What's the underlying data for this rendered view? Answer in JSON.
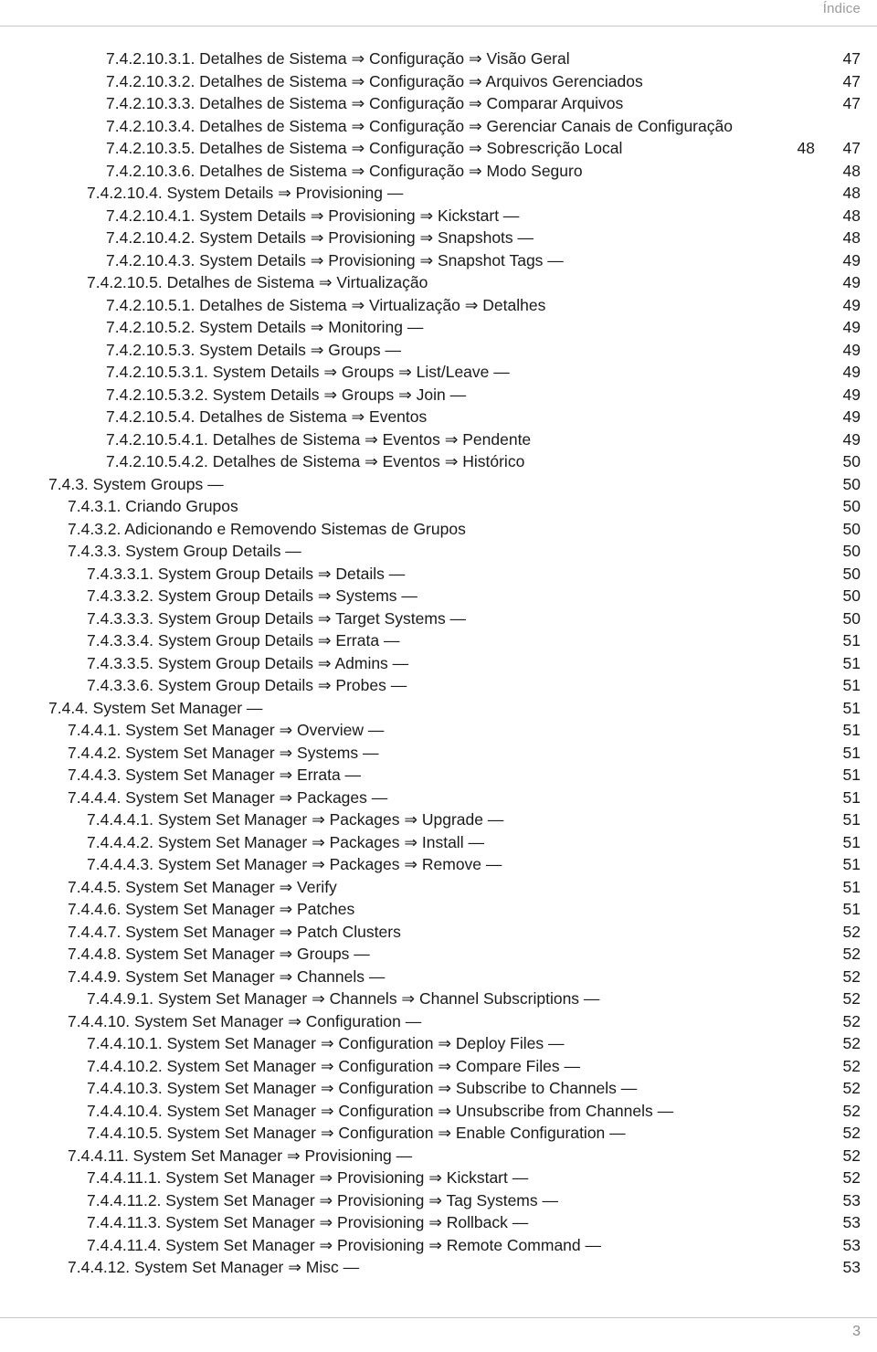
{
  "header": {
    "label": "Índice"
  },
  "footer": {
    "page_number": "3"
  },
  "toc": {
    "entries": [
      {
        "text": "7.4.2.10.3.1. Detalhes de Sistema ⇒ Configuração ⇒ Visão Geral",
        "page": "47",
        "level": 6
      },
      {
        "text": "7.4.2.10.3.2. Detalhes de Sistema ⇒ Configuração ⇒ Arquivos Gerenciados",
        "page": "47",
        "level": 6
      },
      {
        "text": "7.4.2.10.3.3. Detalhes de Sistema ⇒ Configuração ⇒ Comparar Arquivos",
        "page": "47",
        "level": 6
      },
      {
        "text": "7.4.2.10.3.4. Detalhes de Sistema ⇒ Configuração ⇒ Gerenciar Canais de Configuração",
        "page": "",
        "level": 6
      },
      {
        "text": "7.4.2.10.3.5. Detalhes de Sistema ⇒ Configuração ⇒ Sobrescrição Local",
        "page": "47",
        "page_wrapped": "48",
        "level": 6
      },
      {
        "text": "7.4.2.10.3.6. Detalhes de Sistema ⇒ Configuração ⇒ Modo Seguro",
        "page": "48",
        "level": 6
      },
      {
        "text": "7.4.2.10.4. System Details ⇒ Provisioning —",
        "page": "48",
        "level": 5
      },
      {
        "text": "7.4.2.10.4.1. System Details ⇒ Provisioning ⇒ Kickstart —",
        "page": "48",
        "level": 6
      },
      {
        "text": "7.4.2.10.4.2. System Details ⇒ Provisioning ⇒ Snapshots —",
        "page": "48",
        "level": 6
      },
      {
        "text": "7.4.2.10.4.3. System Details ⇒ Provisioning ⇒ Snapshot Tags —",
        "page": "49",
        "level": 6
      },
      {
        "text": "7.4.2.10.5. Detalhes de Sistema ⇒ Virtualização",
        "page": "49",
        "level": 5
      },
      {
        "text": "7.4.2.10.5.1. Detalhes de Sistema ⇒ Virtualização ⇒ Detalhes",
        "page": "49",
        "level": 6
      },
      {
        "text": "7.4.2.10.5.2. System Details ⇒ Monitoring —",
        "page": "49",
        "level": 6
      },
      {
        "text": "7.4.2.10.5.3. System Details ⇒ Groups —",
        "page": "49",
        "level": 6
      },
      {
        "text": "7.4.2.10.5.3.1. System Details ⇒ Groups ⇒ List/Leave —",
        "page": "49",
        "level": 6
      },
      {
        "text": "7.4.2.10.5.3.2. System Details ⇒ Groups ⇒ Join —",
        "page": "49",
        "level": 6
      },
      {
        "text": "7.4.2.10.5.4. Detalhes de Sistema ⇒ Eventos",
        "page": "49",
        "level": 6
      },
      {
        "text": "7.4.2.10.5.4.1. Detalhes de Sistema ⇒ Eventos ⇒ Pendente",
        "page": "49",
        "level": 6
      },
      {
        "text": "7.4.2.10.5.4.2. Detalhes de Sistema ⇒ Eventos ⇒ Histórico",
        "page": "50",
        "level": 6
      },
      {
        "text": "7.4.3. System Groups —",
        "page": "50",
        "level": 3
      },
      {
        "text": "7.4.3.1. Criando Grupos",
        "page": "50",
        "level": 4
      },
      {
        "text": "7.4.3.2. Adicionando e Removendo Sistemas de Grupos",
        "page": "50",
        "level": 4
      },
      {
        "text": "7.4.3.3. System Group Details —",
        "page": "50",
        "level": 4
      },
      {
        "text": "7.4.3.3.1. System Group Details ⇒ Details —",
        "page": "50",
        "level": 5
      },
      {
        "text": "7.4.3.3.2. System Group Details ⇒ Systems —",
        "page": "50",
        "level": 5
      },
      {
        "text": "7.4.3.3.3. System Group Details ⇒ Target Systems —",
        "page": "50",
        "level": 5
      },
      {
        "text": "7.4.3.3.4. System Group Details ⇒ Errata —",
        "page": "51",
        "level": 5
      },
      {
        "text": "7.4.3.3.5. System Group Details ⇒ Admins —",
        "page": "51",
        "level": 5
      },
      {
        "text": "7.4.3.3.6. System Group Details ⇒ Probes —",
        "page": "51",
        "level": 5
      },
      {
        "text": "7.4.4. System Set Manager —",
        "page": "51",
        "level": 3
      },
      {
        "text": "7.4.4.1. System Set Manager ⇒ Overview —",
        "page": "51",
        "level": 4
      },
      {
        "text": "7.4.4.2. System Set Manager ⇒ Systems —",
        "page": "51",
        "level": 4
      },
      {
        "text": "7.4.4.3. System Set Manager ⇒ Errata —",
        "page": "51",
        "level": 4
      },
      {
        "text": "7.4.4.4. System Set Manager ⇒ Packages —",
        "page": "51",
        "level": 4
      },
      {
        "text": "7.4.4.4.1. System Set Manager ⇒ Packages ⇒ Upgrade —",
        "page": "51",
        "level": 5
      },
      {
        "text": "7.4.4.4.2. System Set Manager ⇒ Packages ⇒ Install —",
        "page": "51",
        "level": 5
      },
      {
        "text": "7.4.4.4.3. System Set Manager ⇒ Packages ⇒ Remove —",
        "page": "51",
        "level": 5
      },
      {
        "text": "7.4.4.5. System Set Manager ⇒ Verify",
        "page": "51",
        "level": 4
      },
      {
        "text": "7.4.4.6. System Set Manager ⇒ Patches",
        "page": "51",
        "level": 4
      },
      {
        "text": "7.4.4.7. System Set Manager ⇒ Patch Clusters",
        "page": "52",
        "level": 4
      },
      {
        "text": "7.4.4.8. System Set Manager ⇒ Groups —",
        "page": "52",
        "level": 4
      },
      {
        "text": "7.4.4.9. System Set Manager ⇒ Channels —",
        "page": "52",
        "level": 4
      },
      {
        "text": "7.4.4.9.1. System Set Manager ⇒ Channels ⇒ Channel Subscriptions —",
        "page": "52",
        "level": 5
      },
      {
        "text": "7.4.4.10. System Set Manager ⇒ Configuration —",
        "page": "52",
        "level": 4
      },
      {
        "text": "7.4.4.10.1. System Set Manager ⇒ Configuration ⇒ Deploy Files —",
        "page": "52",
        "level": 5
      },
      {
        "text": "7.4.4.10.2. System Set Manager ⇒ Configuration ⇒ Compare Files —",
        "page": "52",
        "level": 5
      },
      {
        "text": "7.4.4.10.3. System Set Manager ⇒ Configuration ⇒ Subscribe to Channels —",
        "page": "52",
        "level": 5
      },
      {
        "text": "7.4.4.10.4. System Set Manager ⇒ Configuration ⇒ Unsubscribe from Channels —",
        "page": "52",
        "level": 5
      },
      {
        "text": "7.4.4.10.5. System Set Manager ⇒ Configuration ⇒ Enable Configuration —",
        "page": "52",
        "level": 5
      },
      {
        "text": "7.4.4.11. System Set Manager ⇒ Provisioning —",
        "page": "52",
        "level": 4
      },
      {
        "text": "7.4.4.11.1. System Set Manager ⇒ Provisioning ⇒ Kickstart —",
        "page": "52",
        "level": 5
      },
      {
        "text": "7.4.4.11.2. System Set Manager ⇒ Provisioning ⇒ Tag Systems —",
        "page": "53",
        "level": 5
      },
      {
        "text": "7.4.4.11.3. System Set Manager ⇒ Provisioning ⇒ Rollback —",
        "page": "53",
        "level": 5
      },
      {
        "text": "7.4.4.11.4. System Set Manager ⇒ Provisioning ⇒ Remote Command —",
        "page": "53",
        "level": 5
      },
      {
        "text": "7.4.4.12. System Set Manager ⇒ Misc —",
        "page": "53",
        "level": 4
      }
    ]
  }
}
